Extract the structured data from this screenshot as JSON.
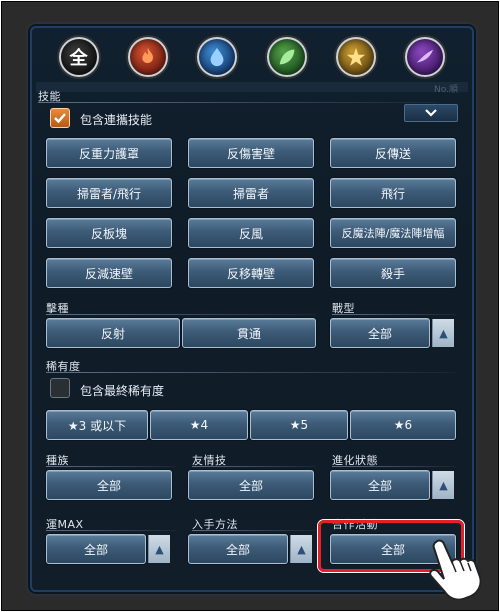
{
  "attributes": [
    {
      "id": "all",
      "label": "全",
      "icon": "all-attribute-icon"
    },
    {
      "id": "fire",
      "label": "",
      "icon": "fire-attribute-icon"
    },
    {
      "id": "water",
      "label": "",
      "icon": "water-attribute-icon"
    },
    {
      "id": "wood",
      "label": "",
      "icon": "wood-attribute-icon"
    },
    {
      "id": "light",
      "label": "",
      "icon": "light-attribute-icon"
    },
    {
      "id": "dark",
      "label": "",
      "icon": "dark-attribute-icon"
    }
  ],
  "faint_text": "No.順",
  "skills": {
    "label": "技能",
    "include_combo_label": "包含連攜技能",
    "include_combo_checked": true,
    "buttons": [
      "反重力護罩",
      "反傷害壁",
      "反傳送",
      "掃雷者/飛行",
      "掃雷者",
      "飛行",
      "反板塊",
      "反風",
      "反魔法陣/魔法陣增幅",
      "反減速壁",
      "反移轉壁",
      "殺手"
    ]
  },
  "attack_type": {
    "label": "擊種",
    "options": [
      "反射",
      "貫通"
    ]
  },
  "battle_type": {
    "label": "戰型",
    "value": "全部"
  },
  "rarity": {
    "label": "稀有度",
    "include_final_label": "包含最終稀有度",
    "include_final_checked": false,
    "options": [
      "★3 或以下",
      "★4",
      "★5",
      "★6"
    ]
  },
  "race": {
    "label": "種族",
    "value": "全部"
  },
  "friendship": {
    "label": "友情技",
    "value": "全部"
  },
  "evolution": {
    "label": "進化狀態",
    "value": "全部"
  },
  "luck": {
    "label": "運MAX",
    "value": "全部"
  },
  "obtain": {
    "label": "入手方法",
    "value": "全部"
  },
  "collab": {
    "label": "合作活動",
    "value": "全部"
  }
}
